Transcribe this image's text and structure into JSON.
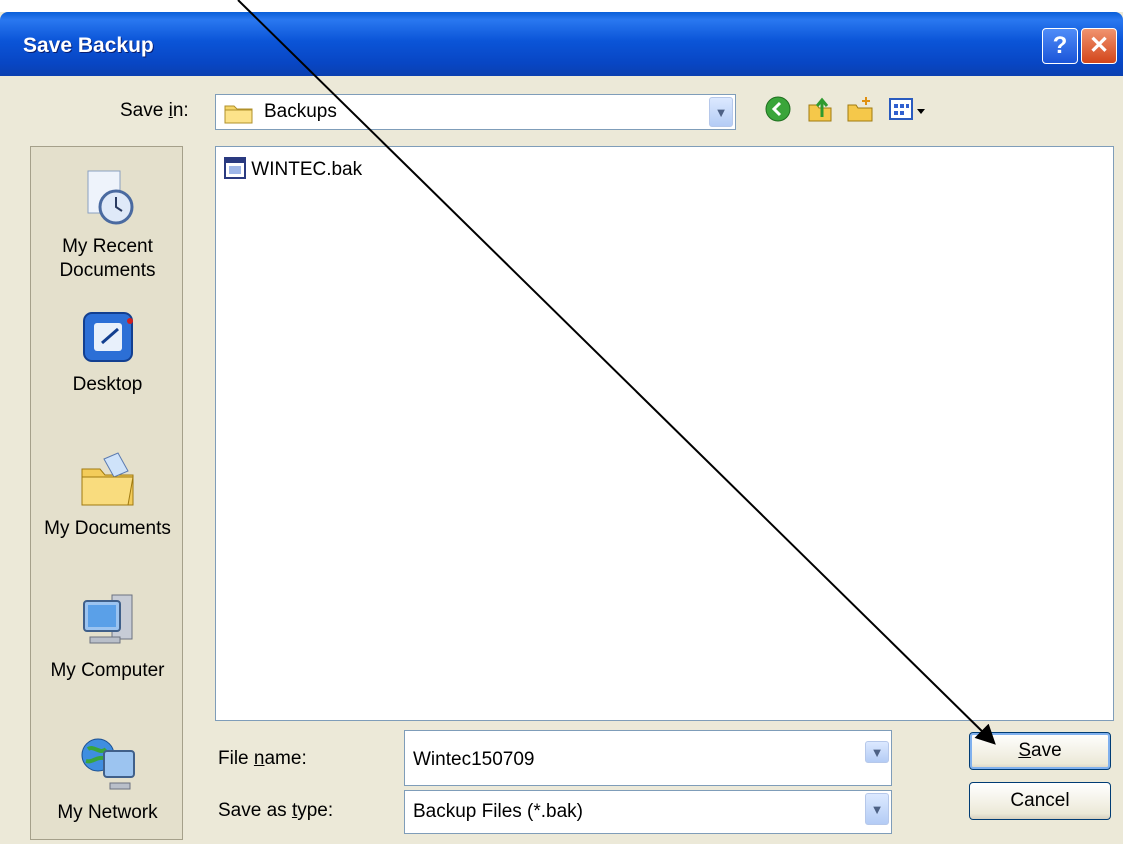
{
  "window": {
    "title": "Save Backup",
    "help_glyph": "?",
    "close_glyph": "✕"
  },
  "toolbar": {
    "save_in_label": "Save in:",
    "location": "Backups",
    "icons": [
      "back-icon",
      "up-folder-icon",
      "new-folder-icon",
      "views-menu-icon"
    ]
  },
  "places": [
    {
      "label_line1": "My Recent",
      "label_line2": "Documents",
      "icon": "recent-documents-icon"
    },
    {
      "label_line1": "Desktop",
      "label_line2": "",
      "icon": "desktop-icon"
    },
    {
      "label_line1": "My Documents",
      "label_line2": "",
      "icon": "my-documents-icon"
    },
    {
      "label_line1": "My Computer",
      "label_line2": "",
      "icon": "my-computer-icon"
    },
    {
      "label_line1": "My Network",
      "label_line2": "",
      "icon": "my-network-icon"
    }
  ],
  "files": [
    {
      "name": "WINTEC.bak",
      "icon": "bak-file-icon"
    }
  ],
  "form": {
    "file_name_label": "File name:",
    "file_name_value": "Wintec150709",
    "save_as_type_label": "Save as type:",
    "save_as_type_value": "Backup Files (*.bak)"
  },
  "buttons": {
    "save": "Save",
    "cancel": "Cancel"
  },
  "colors": {
    "title_bar": "#0a55d8",
    "dialog_bg": "#ece9d8",
    "places_bg": "#e4e0cc",
    "border": "#7f9db9"
  }
}
